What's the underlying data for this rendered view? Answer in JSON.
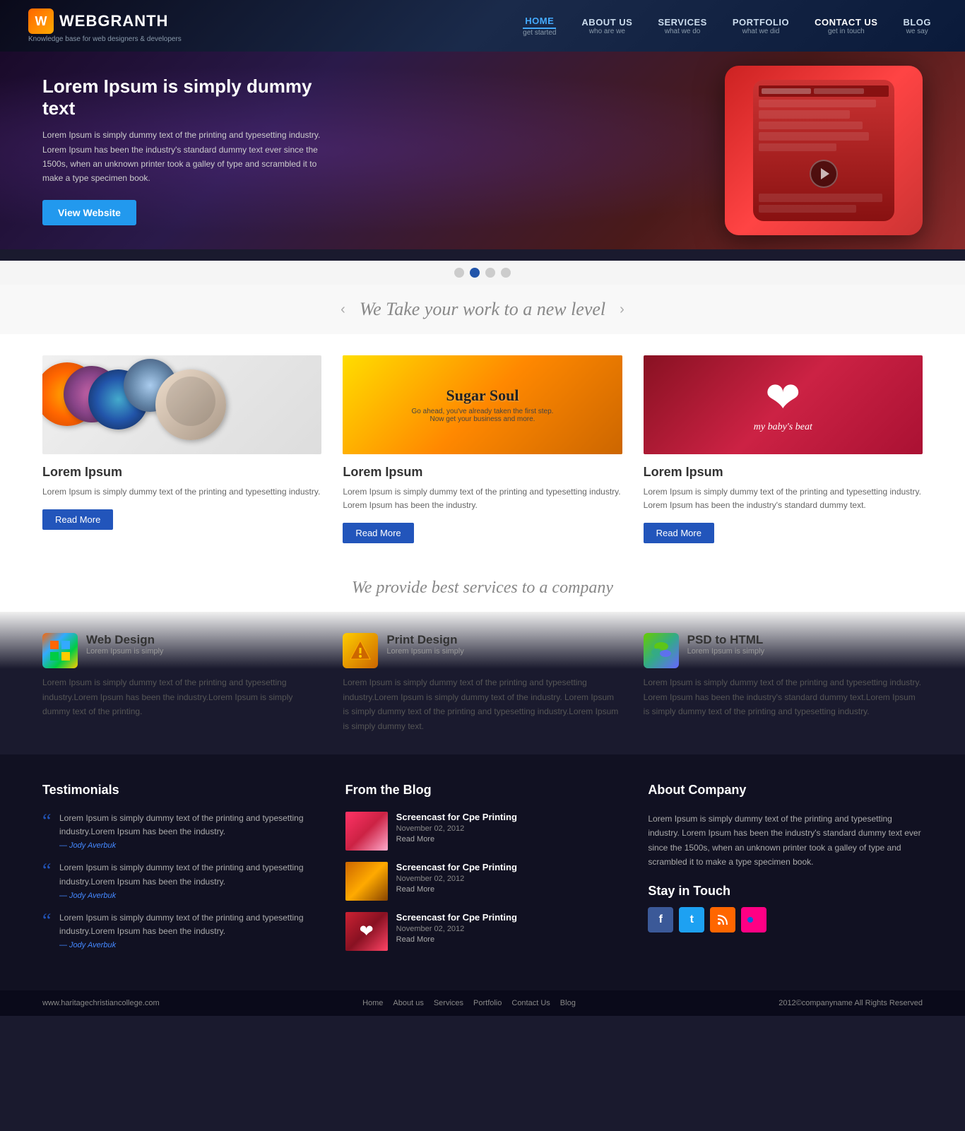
{
  "header": {
    "logo_letter": "W",
    "logo_name": "WEBGRANTH",
    "logo_sub": "Knowledge base for web designers & developers",
    "nav": [
      {
        "id": "home",
        "label": "HOME",
        "sub": "get started",
        "active": true
      },
      {
        "id": "about",
        "label": "ABOUT US",
        "sub": "who are we",
        "active": false
      },
      {
        "id": "services",
        "label": "SERVICES",
        "sub": "what we do",
        "active": false
      },
      {
        "id": "portfolio",
        "label": "PORTFOLIO",
        "sub": "what we did",
        "active": false
      },
      {
        "id": "contact",
        "label": "CONTACT US",
        "sub": "get in touch",
        "active": false
      },
      {
        "id": "blog",
        "label": "BLOG",
        "sub": "we say",
        "active": false
      }
    ]
  },
  "hero": {
    "title": "Lorem Ipsum is simply dummy text",
    "text": "Lorem Ipsum is simply dummy text of the printing and typesetting industry. Lorem Ipsum has been the industry's standard dummy text ever since the 1500s, when an unknown printer took a galley of type and scrambled it to make a type specimen book.",
    "btn_label": "View Website",
    "dots": [
      1,
      2,
      3,
      4
    ],
    "active_dot": 1
  },
  "tagline": {
    "text": "We Take your work to a new level",
    "arrow_left": "‹",
    "arrow_right": "›"
  },
  "portfolio": {
    "title": "Lorem Ipsum",
    "items": [
      {
        "id": "item1",
        "title": "Lorem Ipsum",
        "desc": "Lorem Ipsum is simply dummy text of the printing and typesetting industry.",
        "btn": "Read More"
      },
      {
        "id": "item2",
        "title": "Lorem Ipsum",
        "desc": "Lorem Ipsum is simply dummy text of the printing and typesetting industry. Lorem Ipsum has been the industry.",
        "btn": "Read More"
      },
      {
        "id": "item3",
        "title": "Lorem Ipsum",
        "desc": "Lorem Ipsum is simply dummy text of the printing and typesetting industry. Lorem Ipsum has been the industry's standard dummy text.",
        "btn": "Read More"
      }
    ]
  },
  "services_tagline": "We provide best services to a company",
  "services": {
    "items": [
      {
        "id": "web-design",
        "icon": "webdesign",
        "title": "Web Design",
        "sub": "Lorem Ipsum is simply",
        "desc": "Lorem Ipsum is simply dummy text of the printing and typesetting industry.Lorem Ipsum has been the industry.Lorem Ipsum is simply dummy text of the printing."
      },
      {
        "id": "print-design",
        "icon": "print",
        "title": "Print Design",
        "sub": "Lorem Ipsum is simply",
        "desc": "Lorem Ipsum is simply dummy text of the printing and typesetting industry.Lorem Ipsum is simply dummy text of the industry. Lorem Ipsum is simply dummy text of the printing and typesetting industry.Lorem Ipsum is simply dummy text."
      },
      {
        "id": "psd-html",
        "icon": "psd",
        "title": "PSD to HTML",
        "sub": "Lorem Ipsum is simply",
        "desc": "Lorem Ipsum is simply dummy text of the printing and typesetting industry. Lorem Ipsum has been the industry's standard dummy text.Lorem Ipsum is simply dummy text of the printing and typesetting industry."
      }
    ]
  },
  "testimonials": {
    "title": "Testimonials",
    "items": [
      {
        "text": "Lorem Ipsum is simply dummy text of the printing and typesetting industry.Lorem Ipsum has been the industry.",
        "author": "— Jody Averbuk"
      },
      {
        "text": "Lorem Ipsum is simply dummy text of the printing and typesetting industry.Lorem Ipsum has been the industry.",
        "author": "— Jody Averbuk"
      },
      {
        "text": "Lorem Ipsum is simply dummy text of the printing and typesetting industry.Lorem Ipsum has been the industry.",
        "author": "— Jody Averbuk"
      }
    ]
  },
  "blog": {
    "title": "From the Blog",
    "items": [
      {
        "id": "blog1",
        "title": "Screencast for Cpe Printing",
        "date": "November 02, 2012",
        "read_more": "Read More",
        "thumb_class": "blog-thumb-1"
      },
      {
        "id": "blog2",
        "title": "Screencast for Cpe Printing",
        "date": "November 02, 2012",
        "read_more": "Read More",
        "thumb_class": "blog-thumb-2"
      },
      {
        "id": "blog3",
        "title": "Screencast for Cpe Printing",
        "date": "November 02, 2012",
        "read_more": "Read More",
        "thumb_class": "blog-thumb-3"
      }
    ]
  },
  "about": {
    "title": "About Company",
    "text": "Lorem Ipsum is simply dummy text of the printing and typesetting industry. Lorem Ipsum has been the industry's standard dummy text ever since the 1500s, when an unknown printer took a galley of type and scrambled it to make a type specimen book.",
    "stay_touch_title": "Stay in Touch",
    "social": [
      "facebook",
      "twitter",
      "rss",
      "flickr"
    ]
  },
  "footer": {
    "url": "www.haritagechristiancollege.com",
    "links": [
      "Home",
      "About us",
      "Services",
      "Portfolio",
      "Contact Us",
      "Blog"
    ],
    "copy": "2012©companyname All Rights Reserved"
  }
}
